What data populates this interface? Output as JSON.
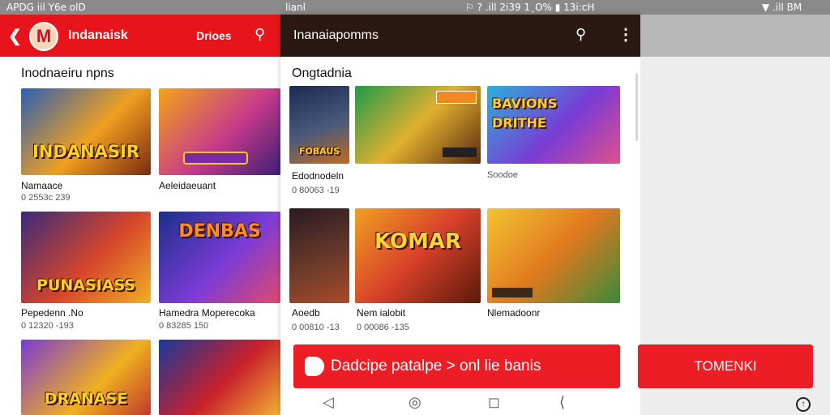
{
  "statusbar": {
    "left": "APDG  iil  Y6e  olD",
    "center": "lianl",
    "mid": "⚐ ? .ill 2i39  1¸O% ▮  13i:cH",
    "right": "▼ .ill  BM"
  },
  "panel_a": {
    "app_title": "Indanaisk",
    "logo_letter": "M",
    "right_label": "Drioes",
    "section_title": "Inodnaeiru npns",
    "items": [
      {
        "thumb_title": "INDANASIR",
        "caption": "Namaace",
        "sub": "0 2553c 239"
      },
      {
        "thumb_title": "",
        "caption": "Aeleidaeuant",
        "sub": ""
      },
      {
        "thumb_title": "PUNASIASS",
        "caption": "Pepedenn .No",
        "sub": "0 12320 -193"
      },
      {
        "thumb_title": "DENBAS",
        "caption": "Hamedra Moperecoka",
        "sub": "0 83285 150"
      },
      {
        "thumb_title": "DRANASE",
        "caption": "",
        "sub": ""
      },
      {
        "thumb_title": "",
        "caption": "",
        "sub": ""
      }
    ]
  },
  "panel_b": {
    "app_title": "Inanaiapomms",
    "section_title": "Ongtadnia",
    "cta_label": "Dadcipe patalpe  >  onl lie banis",
    "items": [
      {
        "thumb_title": "FOBAUS",
        "caption": "Edodnodeln",
        "sub": "0 80063 -19"
      },
      {
        "thumb_title": "",
        "caption": "",
        "sub": ""
      },
      {
        "thumb_title": "BAVIONS DRITHE",
        "caption": "Soodoe",
        "sub": ""
      },
      {
        "thumb_title": "",
        "caption": "Aoedb",
        "sub": "0 00810 -13"
      },
      {
        "thumb_title": "KOMAR",
        "caption": "Nem ialobit",
        "sub": "0 00086 -135"
      },
      {
        "thumb_title": "",
        "caption": "Nlemadoonr",
        "sub": ""
      }
    ]
  },
  "panel_c": {
    "cta_label": "TOMENKI"
  },
  "colors": {
    "brand_red": "#e8141b",
    "dark_bar": "#2a1812"
  }
}
